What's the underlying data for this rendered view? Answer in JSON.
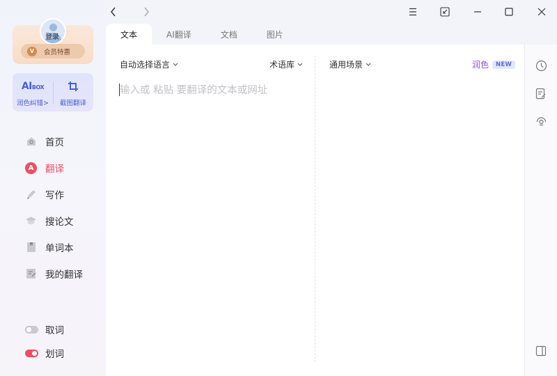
{
  "sidebar": {
    "login_label": "登录",
    "vip_label": "会员特惠",
    "tools": [
      {
        "brand_main": "AI",
        "brand_sub": "BOX",
        "label": "润色纠错>"
      },
      {
        "label": "截图翻译"
      }
    ],
    "nav": [
      {
        "label": "首页",
        "icon": "home-icon"
      },
      {
        "label": "翻译",
        "icon": "translate-icon",
        "active": true
      },
      {
        "label": "写作",
        "icon": "pen-icon"
      },
      {
        "label": "搜论文",
        "icon": "mortarboard-icon"
      },
      {
        "label": "单词本",
        "icon": "notebook-icon"
      },
      {
        "label": "我的翻译",
        "icon": "my-translation-icon"
      }
    ],
    "toggles": [
      {
        "label": "取词",
        "state": "off"
      },
      {
        "label": "划词",
        "state": "on"
      }
    ]
  },
  "tabs": [
    {
      "label": "文本",
      "active": true
    },
    {
      "label": "AI翻译"
    },
    {
      "label": "文档"
    },
    {
      "label": "图片"
    }
  ],
  "translator": {
    "source_language": "自动选择语言",
    "glossary": "术语库",
    "scene": "通用场景",
    "polish_label": "润色",
    "polish_badge": "NEW",
    "input_placeholder": "输入或 粘贴 要翻译的文本或网址",
    "input_value": ""
  },
  "colors": {
    "accent_red": "#ec4f64",
    "accent_blue": "#4a5fd8",
    "accent_purple": "#8d4de8"
  }
}
